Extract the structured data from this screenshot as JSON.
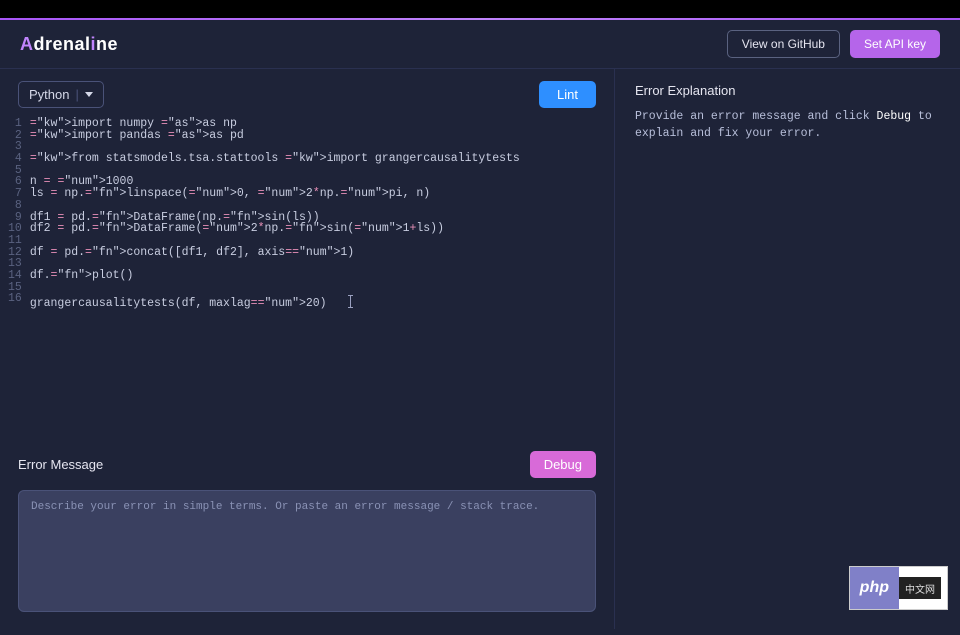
{
  "brand": {
    "full": "Adrenaline",
    "pre": "A",
    "mid": "drenal",
    "accent2": "i",
    "post": "ne"
  },
  "header": {
    "github": "View on GitHub",
    "apikey": "Set API key"
  },
  "toolbar": {
    "language": "Python",
    "lint": "Lint"
  },
  "code": {
    "lines": [
      "import numpy as np",
      "import pandas as pd",
      "",
      "from statsmodels.tsa.stattools import grangercausalitytests",
      "",
      "n = 1000",
      "ls = np.linspace(0, 2*np.pi, n)",
      "",
      "df1 = pd.DataFrame(np.sin(ls))",
      "df2 = pd.DataFrame(2*np.sin(1+ls))",
      "",
      "df = pd.concat([df1, df2], axis=1)",
      "",
      "df.plot()",
      "",
      "grangercausalitytests(df, maxlag=20)"
    ]
  },
  "error_section": {
    "title": "Error Message",
    "debug": "Debug",
    "placeholder": "Describe your error in simple terms. Or paste an error message / stack trace."
  },
  "explanation": {
    "title": "Error Explanation",
    "pre": "Provide an error message and click ",
    "hl": "Debug",
    "post": " to explain and fix your error."
  },
  "badge": {
    "php": "php",
    "cn": "中文网"
  }
}
